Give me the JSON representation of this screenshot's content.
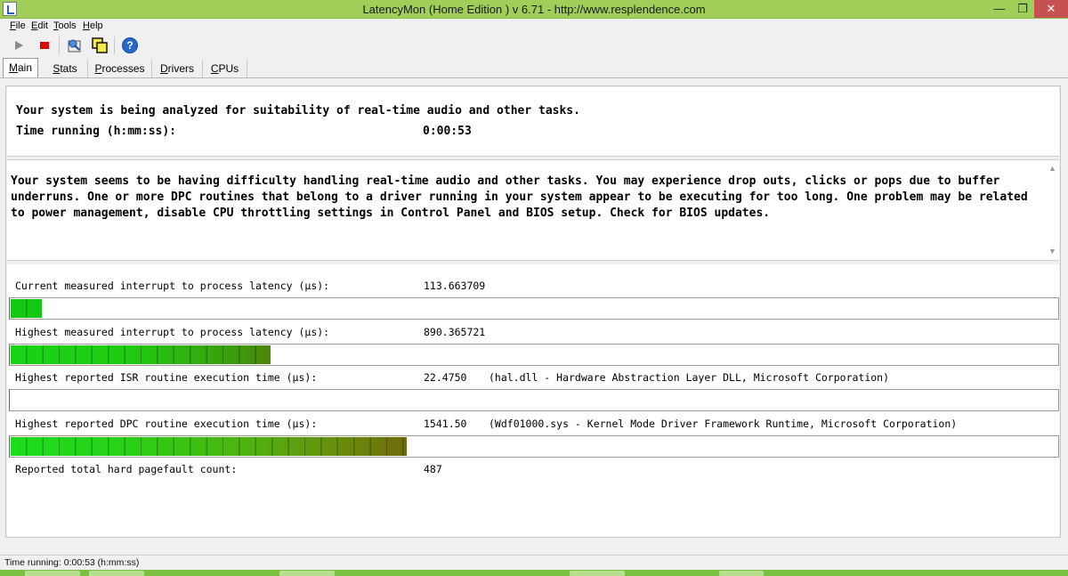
{
  "window": {
    "title": "LatencyMon  (Home Edition )  v 6.71 - http://www.resplendence.com",
    "minimize_glyph": "—",
    "maximize_glyph": "❐",
    "close_glyph": "✕"
  },
  "menu": [
    "File",
    "Edit",
    "Tools",
    "Help"
  ],
  "toolbar": {
    "buttons": [
      "play-icon",
      "stop-icon",
      "report-icon",
      "copy-icon",
      "help-icon"
    ],
    "help_glyph": "?"
  },
  "tabs": [
    "Main",
    "Stats",
    "Processes",
    "Drivers",
    "CPUs"
  ],
  "summary": {
    "headline": "Your system is being analyzed for suitability of real-time audio and other tasks.",
    "time_label": "Time running (h:mm:ss):",
    "time_value": "0:00:53"
  },
  "message": "Your system seems to be having difficulty handling real-time audio and other tasks. You may experience drop outs, clicks or pops due to buffer underruns. One or more DPC routines that belong to a driver running in your system appear to be executing for too long. One problem may be related to power management, disable CPU throttling settings in Control Panel and BIOS setup. Check for BIOS updates.",
  "metrics": [
    {
      "label": "Current measured interrupt to process latency (µs):",
      "value": "113.663709",
      "detail": "",
      "bar_fraction": 0.03
    },
    {
      "label": "Highest measured interrupt to process latency (µs):",
      "value": "890.365721",
      "detail": "",
      "bar_fraction": 0.248
    },
    {
      "label": "Highest reported ISR routine execution time (µs):",
      "value": "22.4750",
      "detail": "(hal.dll - Hardware Abstraction Layer DLL, Microsoft Corporation)",
      "bar_fraction": 0.0
    },
    {
      "label": "Highest reported DPC routine execution time (µs):",
      "value": "1541.50",
      "detail": "(Wdf01000.sys - Kernel Mode Driver Framework Runtime, Microsoft Corporation)",
      "bar_fraction": 0.378
    }
  ],
  "pagefault": {
    "label": "Reported total hard pagefault count:",
    "value": "487"
  },
  "status": {
    "text": "Time running: 0:00:53  (h:mm:ss)"
  },
  "colors": {
    "titlebar": "#9fcf59",
    "bar_start": "#13c713",
    "bar_end": "#6f6a0a",
    "stop": "#e00000"
  }
}
